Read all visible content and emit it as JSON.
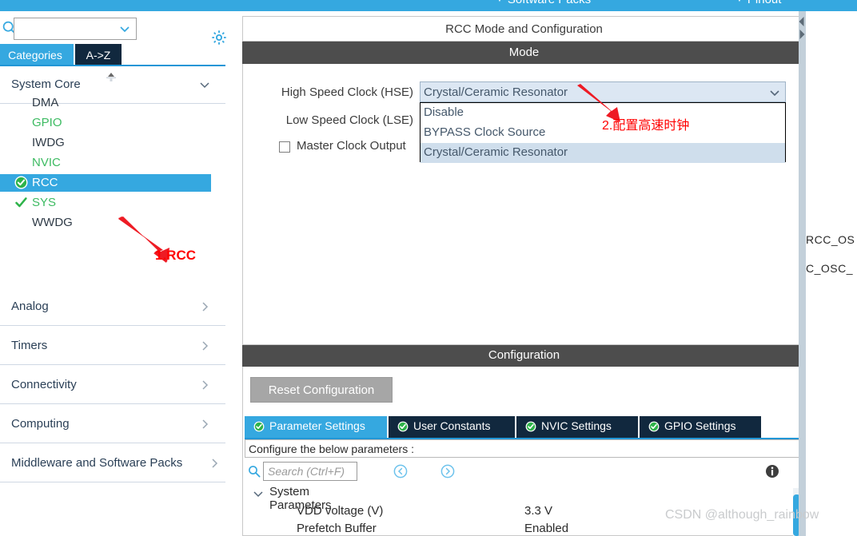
{
  "topmenu": {
    "software_packs": "Software Packs",
    "pinout": "Pinout",
    "caret": "▼"
  },
  "sidebar": {
    "search_value": "",
    "gear_icon": "gear-icon",
    "tabs": [
      {
        "label": "Categories",
        "active": true
      },
      {
        "label": "A->Z",
        "active": false
      }
    ],
    "groups": [
      {
        "label": "System Core",
        "expanded": true
      },
      {
        "label": "Analog",
        "expanded": false
      },
      {
        "label": "Timers",
        "expanded": false
      },
      {
        "label": "Connectivity",
        "expanded": false
      },
      {
        "label": "Computing",
        "expanded": false
      },
      {
        "label": "Middleware and Software Packs",
        "expanded": false
      }
    ],
    "system_core_items": [
      {
        "label": "DMA",
        "state": "dark",
        "badge": "none"
      },
      {
        "label": "GPIO",
        "state": "green",
        "badge": "none"
      },
      {
        "label": "IWDG",
        "state": "dark",
        "badge": "none"
      },
      {
        "label": "NVIC",
        "state": "green",
        "badge": "none"
      },
      {
        "label": "RCC",
        "state": "selected",
        "badge": "check-circle"
      },
      {
        "label": "SYS",
        "state": "green",
        "badge": "check"
      },
      {
        "label": "WWDG",
        "state": "dark",
        "badge": "none"
      }
    ]
  },
  "main": {
    "panel_title": "RCC Mode and Configuration",
    "mode_header": "Mode",
    "labels": {
      "hse": "High Speed Clock (HSE)",
      "lse": "Low Speed Clock (LSE)",
      "mco": "Master Clock Output"
    },
    "mco_checked": false,
    "hse_combo": {
      "value": "Crystal/Ceramic Resonator",
      "open": true,
      "options": [
        {
          "label": "Disable",
          "selected": false
        },
        {
          "label": "BYPASS Clock Source",
          "selected": false
        },
        {
          "label": "Crystal/Ceramic Resonator",
          "selected": true
        }
      ]
    },
    "pin_labels": [
      "RCC_OS",
      "C_OSC_"
    ]
  },
  "configuration": {
    "header": "Configuration",
    "reset_button": "Reset Configuration",
    "tabs": [
      {
        "label": "Parameter Settings",
        "active": true
      },
      {
        "label": "User Constants",
        "active": false
      },
      {
        "label": "NVIC Settings",
        "active": false
      },
      {
        "label": "GPIO Settings",
        "active": false
      }
    ],
    "note": "Configure the below parameters :",
    "search_placeholder": "Search (Ctrl+F)",
    "search_value": "",
    "tree": {
      "group": "System Parameters",
      "rows": [
        {
          "key": "VDD voltage (V)",
          "value": "3.3 V"
        },
        {
          "key": "Prefetch Buffer",
          "value": "Enabled"
        }
      ]
    }
  },
  "annotations": [
    {
      "id": "step-1",
      "text": "1.RCC",
      "color": "#ff0000"
    },
    {
      "id": "step-2",
      "text": "2.配置高速时钟",
      "color": "#ff0000"
    }
  ],
  "watermark": "CSDN @although_rainbow"
}
